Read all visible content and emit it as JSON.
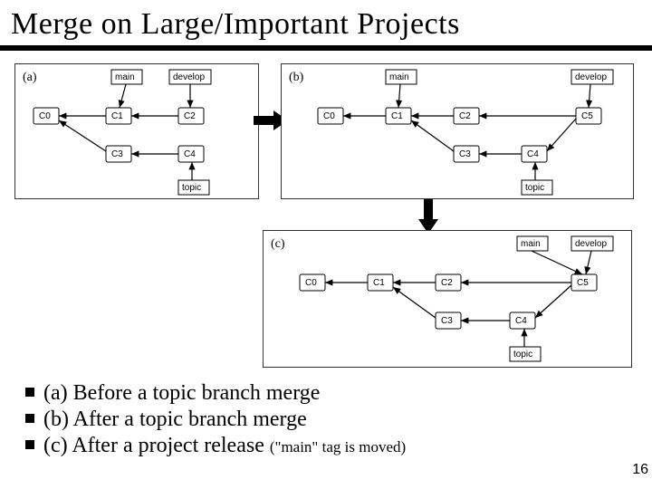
{
  "title": "Merge on Large/Important Projects",
  "page_number": "16",
  "panels": {
    "a": {
      "label": "(a)",
      "branches": {
        "main": "main",
        "develop": "develop",
        "topic": "topic"
      },
      "commits": [
        "C0",
        "C1",
        "C2",
        "C3",
        "C4"
      ]
    },
    "b": {
      "label": "(b)",
      "branches": {
        "main": "main",
        "develop": "develop",
        "topic": "topic"
      },
      "commits": [
        "C0",
        "C1",
        "C2",
        "C3",
        "C4",
        "C5"
      ]
    },
    "c": {
      "label": "(c)",
      "branches": {
        "main": "main",
        "develop": "develop",
        "topic": "topic"
      },
      "commits": [
        "C0",
        "C1",
        "C2",
        "C3",
        "C4",
        "C5"
      ]
    }
  },
  "bullets": [
    {
      "text": "(a) Before a topic branch merge",
      "tail": ""
    },
    {
      "text": "(b) After a topic branch merge",
      "tail": ""
    },
    {
      "text": "(c) After a project release ",
      "tail": "(\"main\" tag is moved)"
    }
  ]
}
